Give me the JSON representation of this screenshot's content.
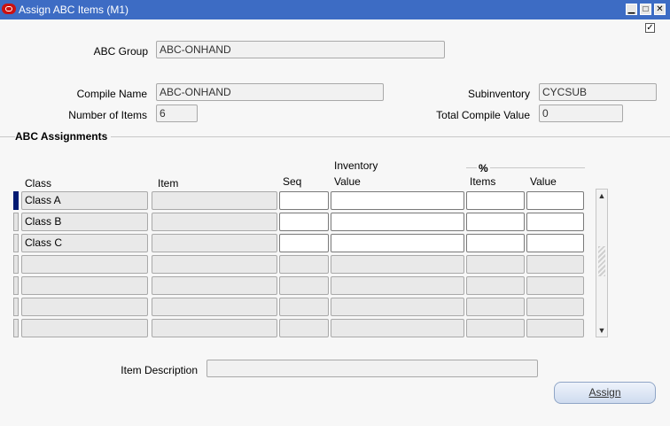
{
  "window": {
    "title": "Assign ABC Items (M1)",
    "min_glyph": "▁",
    "max_glyph": "□",
    "close_glyph": "✕",
    "check_glyph": "✓"
  },
  "header": {
    "abc_group_label": "ABC Group",
    "abc_group_value": "ABC-ONHAND",
    "compile_name_label": "Compile Name",
    "compile_name_value": "ABC-ONHAND",
    "number_of_items_label": "Number of Items",
    "number_of_items_value": "6",
    "subinventory_label": "Subinventory",
    "subinventory_value": "CYCSUB",
    "total_compile_value_label": "Total Compile Value",
    "total_compile_value_value": "0"
  },
  "assignments": {
    "section_title": "ABC Assignments",
    "columns": {
      "class": "Class",
      "item": "Item",
      "seq": "Seq",
      "inv_value_top": "Inventory",
      "inv_value_bottom": "Value",
      "pct": "%",
      "pct_items": "Items",
      "pct_value": "Value"
    },
    "rows": [
      {
        "class": "Class A"
      },
      {
        "class": "Class B"
      },
      {
        "class": "Class C"
      },
      {
        "class": ""
      },
      {
        "class": ""
      },
      {
        "class": ""
      },
      {
        "class": ""
      }
    ]
  },
  "footer": {
    "item_description_label": "Item Description",
    "item_description_value": "",
    "assign_label": "Assign"
  }
}
